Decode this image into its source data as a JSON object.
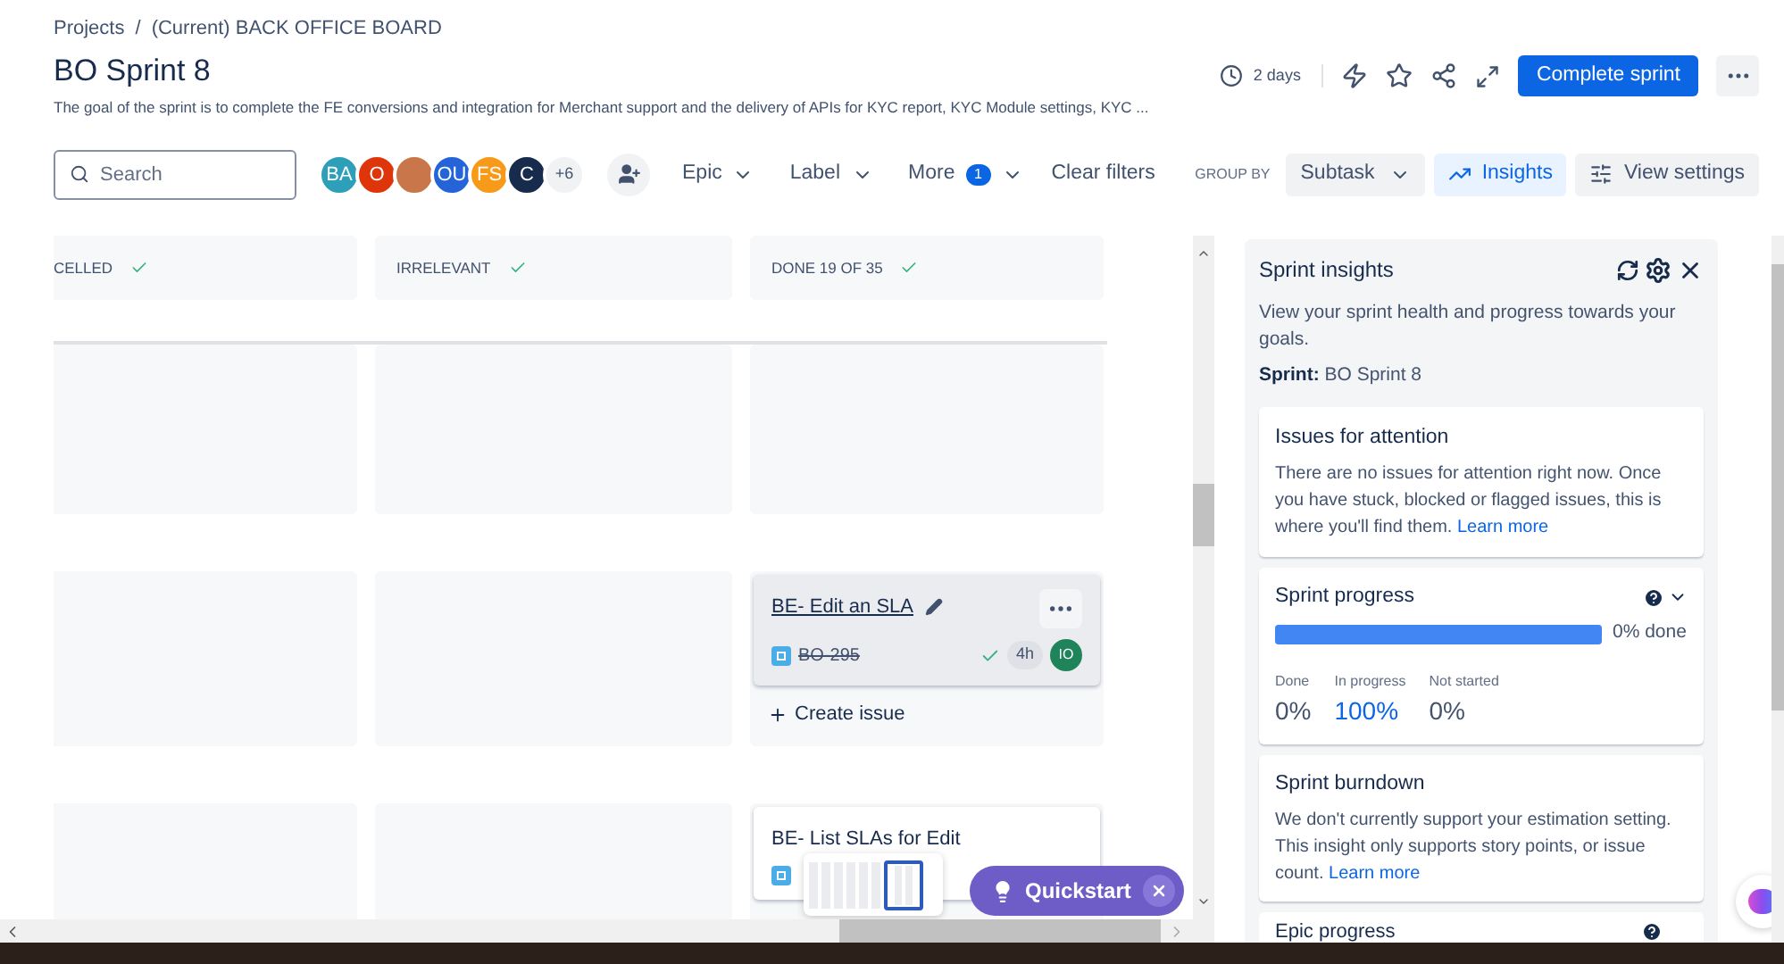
{
  "breadcrumbs": [
    "Projects",
    "(Current) BACK OFFICE BOARD"
  ],
  "breadcrumb_separator": "/",
  "title": "BO Sprint 8",
  "goal": "The goal of the sprint is to complete the FE conversions and integration for Merchant support and the delivery of APIs for KYC report, KYC Module settings, KYC ...",
  "time_remaining": "2 days",
  "complete_button": "Complete sprint",
  "search": {
    "placeholder": "Search"
  },
  "avatars": [
    {
      "initials": "BA",
      "color": "#2e9fb8",
      "kind": "initials"
    },
    {
      "initials": "O",
      "color": "#de350b",
      "kind": "initials"
    },
    {
      "kind": "photo",
      "color": "#c9764a"
    },
    {
      "initials": "OU",
      "color": "#2464d8",
      "kind": "initials"
    },
    {
      "initials": "FS",
      "color": "#f79a1a",
      "kind": "initials"
    },
    {
      "initials": "C",
      "color": "#172b4d",
      "kind": "initials"
    }
  ],
  "more_avatars": "+6",
  "filters": [
    {
      "label": "Epic"
    },
    {
      "label": "Label"
    },
    {
      "label": "More",
      "badge": "1"
    }
  ],
  "clear_filters": "Clear filters",
  "group_by": {
    "label": "GROUP BY",
    "value": "Subtask"
  },
  "insights_button": {
    "label": "Insights",
    "selected": true
  },
  "view_settings": "View settings",
  "columns": [
    {
      "title": "CELLED"
    },
    {
      "title": "IRRELEVANT"
    },
    {
      "title": "DONE 19 OF 35"
    }
  ],
  "lanes": [
    {
      "kind": "blank"
    },
    {
      "kind": "cards",
      "cards": [
        {
          "title": "BE- Edit an SLA",
          "key": "BO-295",
          "done": true,
          "estimate": "4h",
          "assignee": "IO",
          "hovered": true
        }
      ],
      "create_issue": "Create issue"
    },
    {
      "kind": "cards",
      "cards": [
        {
          "title": "BE- List SLAs for Edit",
          "hovered": false
        }
      ]
    }
  ],
  "quickstart": "Quickstart",
  "insights": {
    "title": "Sprint insights",
    "description": "View your sprint health and progress towards your goals.",
    "sprint_label": "Sprint:",
    "sprint_value": "BO Sprint 8",
    "attention": {
      "title": "Issues for attention",
      "text": "There are no issues for attention right now. Once you have stuck, blocked or flagged issues, this is where you'll find them.",
      "link": "Learn more"
    },
    "progress": {
      "title": "Sprint progress",
      "level": 1,
      "reading": "0% done",
      "stats": [
        {
          "label": "Done",
          "value": "0%",
          "highlighted": false
        },
        {
          "label": "In progress",
          "value": "100%",
          "highlighted": true
        },
        {
          "label": "Not started",
          "value": "0%",
          "highlighted": false
        }
      ]
    },
    "burndown": {
      "title": "Sprint burndown",
      "text": "We don't currently support your estimation setting. This insight only supports story points, or issue count.",
      "link": "Learn more"
    },
    "epic": {
      "title": "Epic progress"
    }
  }
}
